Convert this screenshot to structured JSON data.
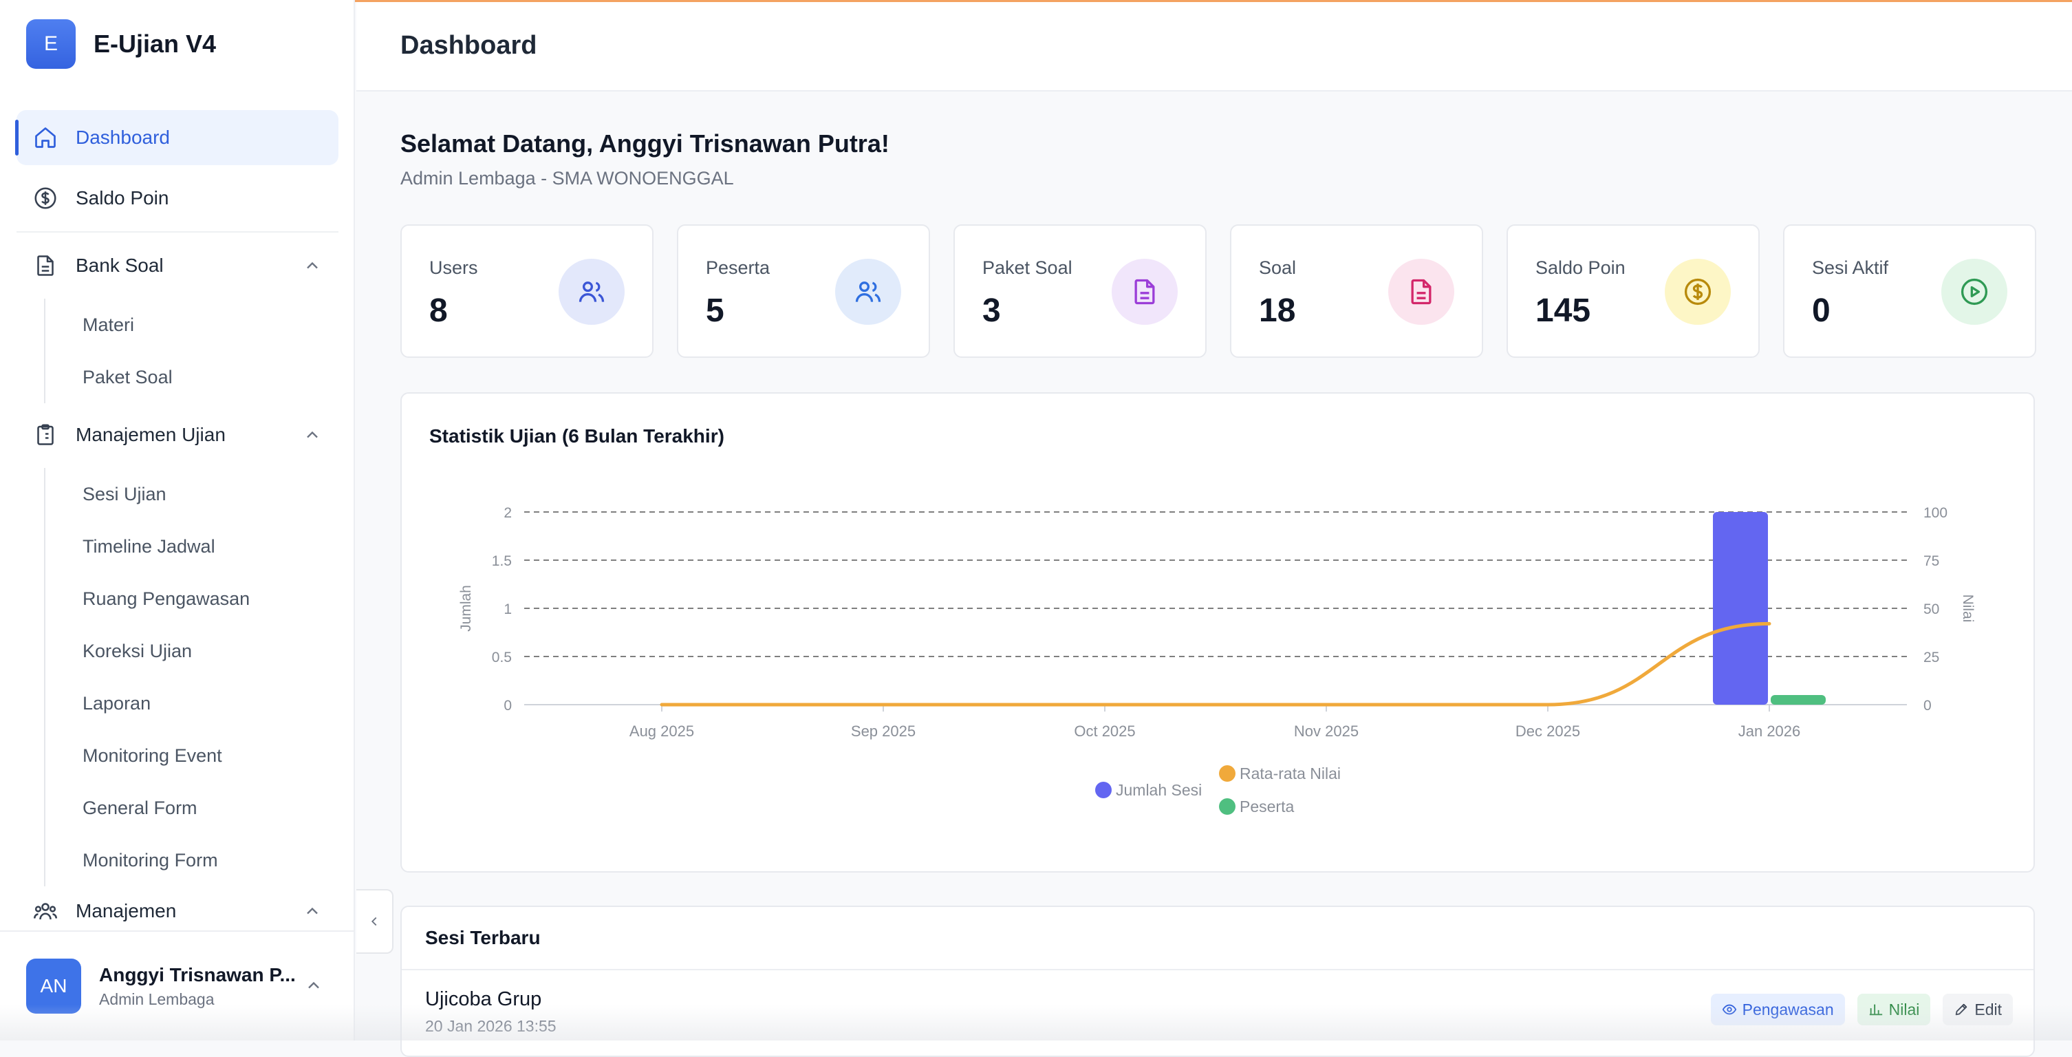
{
  "app": {
    "logo_letter": "E",
    "name": "E-Ujian V4",
    "accent": "#3563e0"
  },
  "sidebar": {
    "items": [
      {
        "label": "Dashboard",
        "icon": "home-icon",
        "active": true
      },
      {
        "label": "Saldo Poin",
        "icon": "dollar-circle-icon"
      },
      {
        "label": "Bank Soal",
        "icon": "document-icon",
        "expanded": true,
        "children": [
          "Materi",
          "Paket Soal"
        ]
      },
      {
        "label": "Manajemen Ujian",
        "icon": "clipboard-icon",
        "expanded": true,
        "children": [
          "Sesi Ujian",
          "Timeline Jadwal",
          "Ruang Pengawasan",
          "Koreksi Ujian",
          "Laporan",
          "Monitoring Event",
          "General Form",
          "Monitoring Form"
        ]
      },
      {
        "label": "Manajemen",
        "icon": "users-group-icon",
        "expanded": true
      }
    ],
    "user": {
      "initials": "AN",
      "name": "Anggyi Trisnawan P...",
      "role": "Admin Lembaga"
    }
  },
  "header": {
    "title": "Dashboard"
  },
  "welcome": {
    "greeting": "Selamat Datang, Anggyi Trisnawan Putra!",
    "subtitle": "Admin Lembaga - SMA WONOENGGAL"
  },
  "stats": [
    {
      "label": "Users",
      "value": "8",
      "icon": "users-icon",
      "color": "#3b56d6",
      "bg": "#e3e8fb"
    },
    {
      "label": "Peserta",
      "value": "5",
      "icon": "users-icon",
      "color": "#2f6fe0",
      "bg": "#e1ebfb"
    },
    {
      "label": "Paket Soal",
      "value": "3",
      "icon": "file-text-icon",
      "color": "#9b3ed8",
      "bg": "#f1e6fb"
    },
    {
      "label": "Soal",
      "value": "18",
      "icon": "file-text-icon",
      "color": "#d3276a",
      "bg": "#fbe4ee"
    },
    {
      "label": "Saldo Poin",
      "value": "145",
      "icon": "dollar-circle-icon",
      "color": "#b88a0c",
      "bg": "#fdf6c6"
    },
    {
      "label": "Sesi Aktif",
      "value": "0",
      "icon": "play-circle-icon",
      "color": "#2f9a54",
      "bg": "#e3f6e8"
    }
  ],
  "chart_data": {
    "type": "bar",
    "title": "Statistik Ujian (6 Bulan Terakhir)",
    "categories": [
      "Aug 2025",
      "Sep 2025",
      "Oct 2025",
      "Nov 2025",
      "Dec 2025",
      "Jan 2026"
    ],
    "ylabel_left": "Jumlah",
    "ylabel_right": "Nilai",
    "ylim_left": [
      0,
      2
    ],
    "ylim_right": [
      0,
      100
    ],
    "yticks_left": [
      "0",
      "0.5",
      "1",
      "1.5",
      "2"
    ],
    "yticks_right": [
      "0",
      "25",
      "50",
      "75",
      "100"
    ],
    "grid": true,
    "series": [
      {
        "name": "Jumlah Sesi",
        "type": "bar",
        "axis": "left",
        "color": "#6366f1",
        "values": [
          0,
          0,
          0,
          0,
          0,
          2
        ]
      },
      {
        "name": "Rata-rata Nilai",
        "type": "line",
        "axis": "right",
        "color": "#f0a93b",
        "values": [
          0,
          0,
          0,
          0,
          0,
          42
        ]
      },
      {
        "name": "Peserta",
        "type": "bar",
        "axis": "left",
        "color": "#4fbf80",
        "values": [
          0,
          0,
          0,
          0,
          0,
          0.1
        ]
      }
    ],
    "legend": "bottom"
  },
  "recent": {
    "title": "Sesi Terbaru",
    "rows": [
      {
        "name": "Ujicoba Grup",
        "date": "20 Jan 2026 13:55",
        "actions": [
          "Pengawasan",
          "Nilai",
          "Edit"
        ]
      }
    ]
  }
}
